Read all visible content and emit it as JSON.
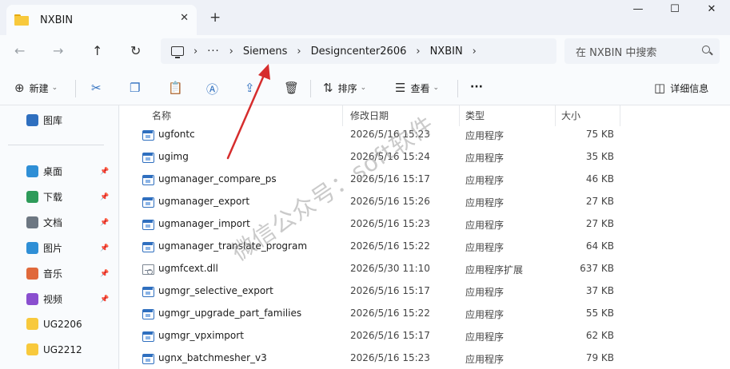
{
  "window": {
    "tab_title": "NXBIN",
    "tab_close": "✕",
    "new_tab": "+",
    "minimize": "—",
    "maximize": "☐",
    "close": "✕"
  },
  "nav": {
    "back": "←",
    "forward": "→",
    "up": "↑",
    "refresh": "↻"
  },
  "address": {
    "overflow": "···",
    "separator": "›",
    "crumbs": [
      "Siemens",
      "Designcenter2606",
      "NXBIN"
    ]
  },
  "search": {
    "placeholder": "在 NXBIN 中搜索"
  },
  "toolbar": {
    "new_label": "新建",
    "sort_label": "排序",
    "view_label": "查看",
    "more_label": "···",
    "details_label": "详细信息",
    "caret": "⌄"
  },
  "sidebar": {
    "items": [
      {
        "label": "图库",
        "icon": "gallery-icon",
        "color": "#2f6fbf",
        "pinned": false
      },
      {
        "label": "桌面",
        "icon": "desktop-icon",
        "color": "#2f8fd6",
        "pinned": true
      },
      {
        "label": "下载",
        "icon": "download-icon",
        "color": "#2e9b5a",
        "pinned": true
      },
      {
        "label": "文档",
        "icon": "document-icon",
        "color": "#6d7782",
        "pinned": true
      },
      {
        "label": "图片",
        "icon": "pictures-icon",
        "color": "#2f8fd6",
        "pinned": true
      },
      {
        "label": "音乐",
        "icon": "music-icon",
        "color": "#e0693b",
        "pinned": true
      },
      {
        "label": "视频",
        "icon": "video-icon",
        "color": "#8a4fcf",
        "pinned": true
      },
      {
        "label": "UG2206",
        "icon": "folder-icon",
        "color": "#f8c93c",
        "pinned": false
      },
      {
        "label": "UG2212",
        "icon": "folder-icon",
        "color": "#f8c93c",
        "pinned": false
      }
    ],
    "pin_glyph": "📌"
  },
  "columns": {
    "name": "名称",
    "date": "修改日期",
    "type": "类型",
    "size": "大小"
  },
  "files": [
    {
      "name": "ugfontc",
      "date": "2026/5/16 15:23",
      "type": "应用程序",
      "size": "75 KB",
      "kind": "exe"
    },
    {
      "name": "ugimg",
      "date": "2026/5/16 15:24",
      "type": "应用程序",
      "size": "35 KB",
      "kind": "exe"
    },
    {
      "name": "ugmanager_compare_ps",
      "date": "2026/5/16 15:17",
      "type": "应用程序",
      "size": "46 KB",
      "kind": "exe"
    },
    {
      "name": "ugmanager_export",
      "date": "2026/5/16 15:26",
      "type": "应用程序",
      "size": "27 KB",
      "kind": "exe"
    },
    {
      "name": "ugmanager_import",
      "date": "2026/5/16 15:23",
      "type": "应用程序",
      "size": "27 KB",
      "kind": "exe"
    },
    {
      "name": "ugmanager_translate_program",
      "date": "2026/5/16 15:22",
      "type": "应用程序",
      "size": "64 KB",
      "kind": "exe"
    },
    {
      "name": "ugmfcext.dll",
      "date": "2026/5/30 11:10",
      "type": "应用程序扩展",
      "size": "637 KB",
      "kind": "dll"
    },
    {
      "name": "ugmgr_selective_export",
      "date": "2026/5/16 15:17",
      "type": "应用程序",
      "size": "37 KB",
      "kind": "exe"
    },
    {
      "name": "ugmgr_upgrade_part_families",
      "date": "2026/5/16 15:22",
      "type": "应用程序",
      "size": "55 KB",
      "kind": "exe"
    },
    {
      "name": "ugmgr_vpximport",
      "date": "2026/5/16 15:17",
      "type": "应用程序",
      "size": "62 KB",
      "kind": "exe"
    },
    {
      "name": "ugnx_batchmesher_v3",
      "date": "2026/5/16 15:23",
      "type": "应用程序",
      "size": "79 KB",
      "kind": "exe"
    }
  ],
  "watermark": "微信公众号：soft软件",
  "colors": {
    "accent": "#2f6fbf",
    "arrow": "#d62d2d",
    "folder": "#f8c93c"
  }
}
